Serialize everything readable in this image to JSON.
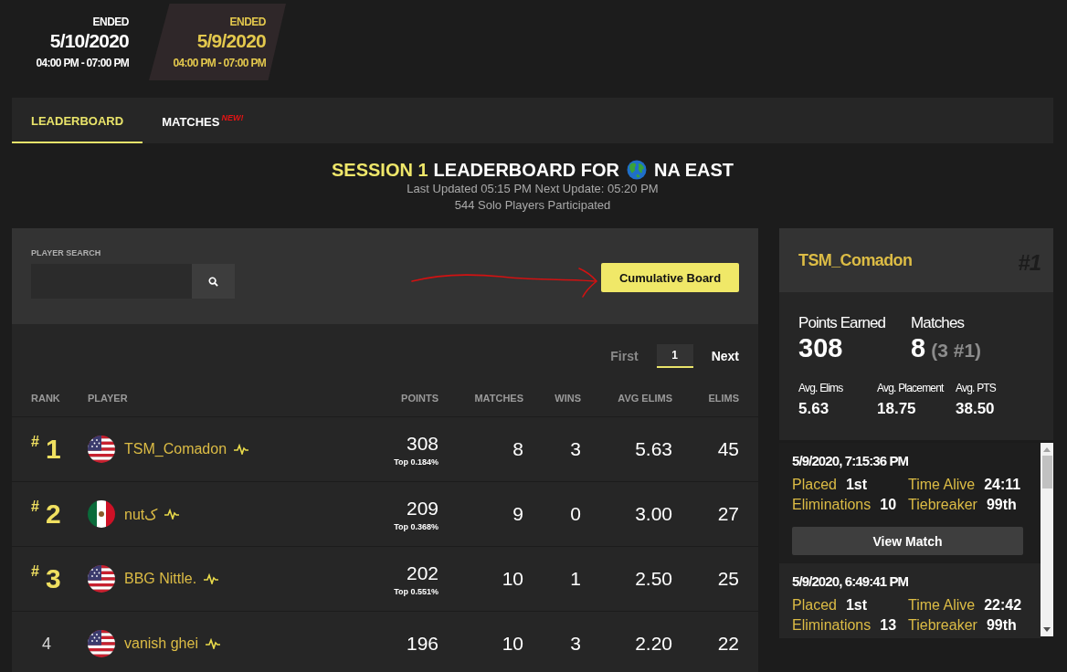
{
  "sessions": [
    {
      "status": "ENDED",
      "date": "5/10/2020",
      "time": "04:00 PM - 07:00 PM",
      "selected": false
    },
    {
      "status": "ENDED",
      "date": "5/9/2020",
      "time": "04:00 PM - 07:00 PM",
      "selected": true
    }
  ],
  "tabs": [
    {
      "label": "LEADERBOARD",
      "selected": true
    },
    {
      "label": "MATCHES",
      "badge": "NEW!",
      "selected": false
    }
  ],
  "heading": {
    "session": "SESSION 1",
    "title": "LEADERBOARD FOR",
    "region": "NA EAST",
    "updated": "Last Updated 05:15 PM Next Update: 05:20 PM",
    "participants": "544 Solo Players Participated"
  },
  "search": {
    "label": "PLAYER SEARCH"
  },
  "cumulative_button": "Cumulative Board",
  "pagination": {
    "first": "First",
    "pages": [
      {
        "label": "1",
        "selected": true
      }
    ],
    "next": "Next"
  },
  "table": {
    "columns": [
      "RANK",
      "PLAYER",
      "POINTS",
      "MATCHES",
      "WINS",
      "AVG ELIMS",
      "ELIMS"
    ],
    "rows": [
      {
        "rank_mark": "#",
        "rank": "1",
        "podium": true,
        "flag": {
          "kind": "us"
        },
        "player": "TSM_Comadon",
        "points": "308",
        "top_share": "Top 0.184%",
        "matches": "8",
        "wins": "3",
        "avg_elims": "5.63",
        "elims": "45"
      },
      {
        "rank_mark": "#",
        "rank": "2",
        "podium": true,
        "flag": {
          "kind": "mx"
        },
        "player": "nutک",
        "points": "209",
        "top_share": "Top 0.368%",
        "matches": "9",
        "wins": "0",
        "avg_elims": "3.00",
        "elims": "27"
      },
      {
        "rank_mark": "#",
        "rank": "3",
        "podium": true,
        "flag": {
          "kind": "us"
        },
        "player": "BBG Nittle.",
        "points": "202",
        "top_share": "Top 0.551%",
        "matches": "10",
        "wins": "1",
        "avg_elims": "2.50",
        "elims": "25"
      },
      {
        "rank": "4",
        "podium": false,
        "flag": {
          "kind": "us"
        },
        "player": "vanish ghei",
        "points": "196",
        "matches": "10",
        "wins": "3",
        "avg_elims": "2.20",
        "elims": "22"
      }
    ]
  },
  "player_card": {
    "name": "TSM_Comadon",
    "rank": "#1",
    "points_label": "Points Earned",
    "points": "308",
    "matches_label": "Matches",
    "matches": "8",
    "matches_detail": "(3 #1)",
    "averages": [
      {
        "label": "Avg. Elims",
        "value": "5.63"
      },
      {
        "label": "Avg. Placement",
        "value": "18.75"
      },
      {
        "label": "Avg. PTS",
        "value": "38.50"
      }
    ]
  },
  "recent_matches": [
    {
      "time": "5/9/2020, 7:15:36 PM",
      "stats": [
        {
          "label": "Placed",
          "value": "1st"
        },
        {
          "label": "Time Alive",
          "value": "24:11"
        },
        {
          "label": "Eliminations",
          "value": "10"
        },
        {
          "label": "Tiebreaker",
          "value": "99th"
        }
      ],
      "button": "View Match"
    },
    {
      "time": "5/9/2020, 6:49:41 PM",
      "stats": [
        {
          "label": "Placed",
          "value": "1st"
        },
        {
          "label": "Time Alive",
          "value": "22:42"
        },
        {
          "label": "Eliminations",
          "value": "13"
        },
        {
          "label": "Tiebreaker",
          "value": "99th"
        }
      ]
    }
  ]
}
